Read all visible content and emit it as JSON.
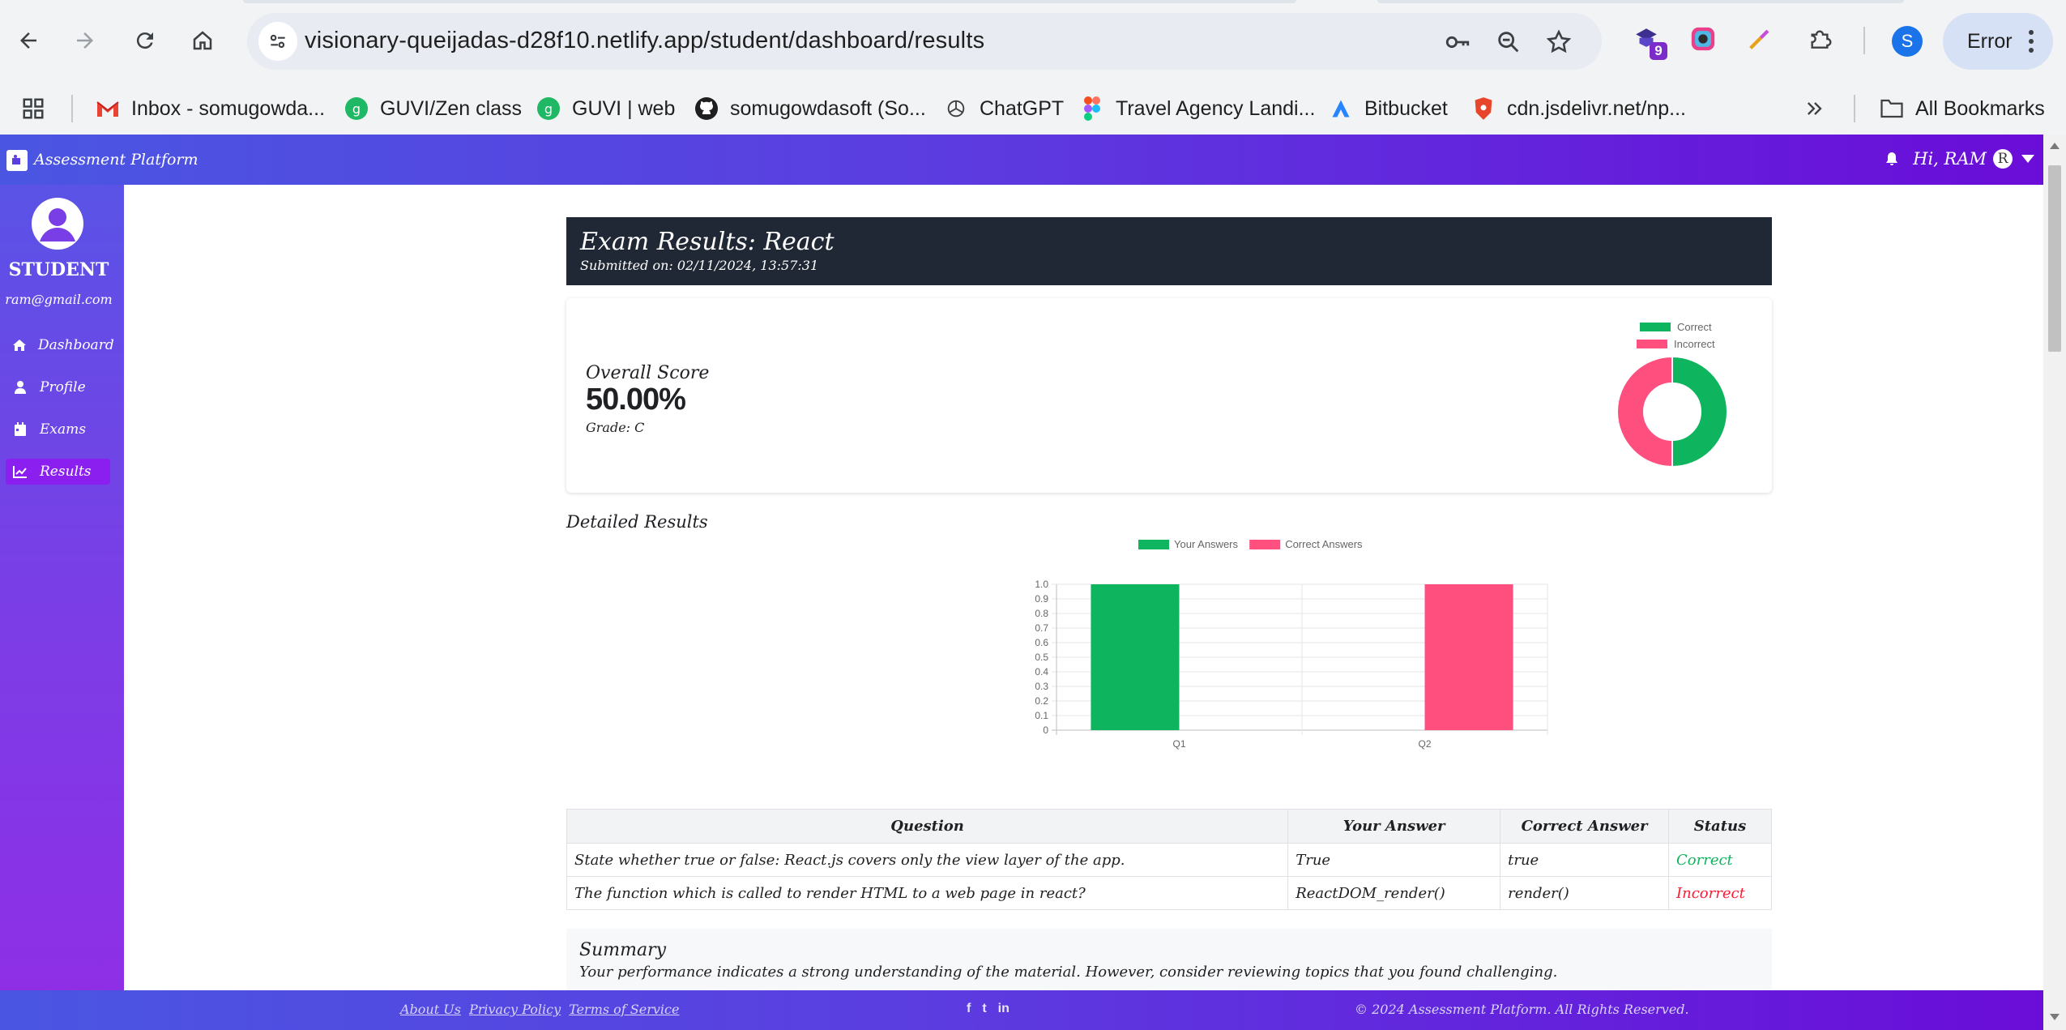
{
  "browser": {
    "url": "visionary-queijadas-d28f10.netlify.app/student/dashboard/results",
    "extension_badge": "9",
    "profile_initial": "S",
    "error_label": "Error",
    "bookmarks": [
      {
        "label": "Inbox - somugowda...",
        "icon": "gmail-icon"
      },
      {
        "label": "GUVI/Zen class",
        "icon": "guvi-icon"
      },
      {
        "label": "GUVI | web",
        "icon": "guvi-icon"
      },
      {
        "label": "somugowdasoft (So...",
        "icon": "github-icon"
      },
      {
        "label": "ChatGPT",
        "icon": "chatgpt-icon"
      },
      {
        "label": "Travel Agency Landi...",
        "icon": "figma-icon"
      },
      {
        "label": "Bitbucket",
        "icon": "bitbucket-icon"
      },
      {
        "label": "cdn.jsdelivr.net/np...",
        "icon": "brave-icon"
      }
    ],
    "all_bookmarks": "All Bookmarks"
  },
  "header": {
    "app_name": "Assessment Platform",
    "greeting": "Hi, RAM",
    "avatar_initial": "R"
  },
  "sidebar": {
    "role": "STUDENT",
    "email": "ram@gmail.com",
    "items": [
      {
        "label": "Dashboard",
        "icon": "home-icon"
      },
      {
        "label": "Profile",
        "icon": "user-icon"
      },
      {
        "label": "Exams",
        "icon": "calendar-icon"
      },
      {
        "label": "Results",
        "icon": "chart-line-icon"
      }
    ]
  },
  "exam": {
    "title": "Exam Results: React",
    "submitted": "Submitted on: 02/11/2024, 13:57:31"
  },
  "score": {
    "label": "Overall Score",
    "value": "50.00%",
    "grade": "Grade: C"
  },
  "detailed_title": "Detailed Results",
  "chart_data": [
    {
      "type": "pie",
      "donut": true,
      "categories": [
        "Correct",
        "Incorrect"
      ],
      "values": [
        1,
        1
      ],
      "colors": [
        "#0fb45f",
        "#ff4f7e"
      ],
      "legend": "top"
    },
    {
      "type": "bar",
      "categories": [
        "Q1",
        "Q2"
      ],
      "series": [
        {
          "name": "Your Answers",
          "values": [
            1,
            0
          ],
          "color": "#0fb45f"
        },
        {
          "name": "Correct Answers",
          "values": [
            0,
            1
          ],
          "color": "#ff4f7e"
        }
      ],
      "ylim": [
        0,
        1
      ],
      "yticks": [
        "0",
        "0.1",
        "0.2",
        "0.3",
        "0.4",
        "0.5",
        "0.6",
        "0.7",
        "0.8",
        "0.9",
        "1.0"
      ],
      "grid": true,
      "legend": "top"
    }
  ],
  "table": {
    "headers": [
      "Question",
      "Your Answer",
      "Correct Answer",
      "Status"
    ],
    "rows": [
      {
        "question": "State whether true or false: React.js covers only the view layer of the app.",
        "your": "True",
        "correct": "true",
        "status": "Correct",
        "status_color": "#0fb45f"
      },
      {
        "question": "The function which is called to render HTML to a web page in react?",
        "your": "ReactDOM_render()",
        "correct": "render()",
        "status": "Incorrect",
        "status_color": "#ff1a33"
      }
    ]
  },
  "summary": {
    "title": "Summary",
    "text": "Your performance indicates a strong understanding of the material. However, consider reviewing topics that you found challenging."
  },
  "footer": {
    "links": [
      "About Us",
      "Privacy Policy",
      "Terms of Service"
    ],
    "social": [
      "f",
      "t",
      "in"
    ],
    "copyright": "© 2024 Assessment Platform. All Rights Reserved."
  }
}
